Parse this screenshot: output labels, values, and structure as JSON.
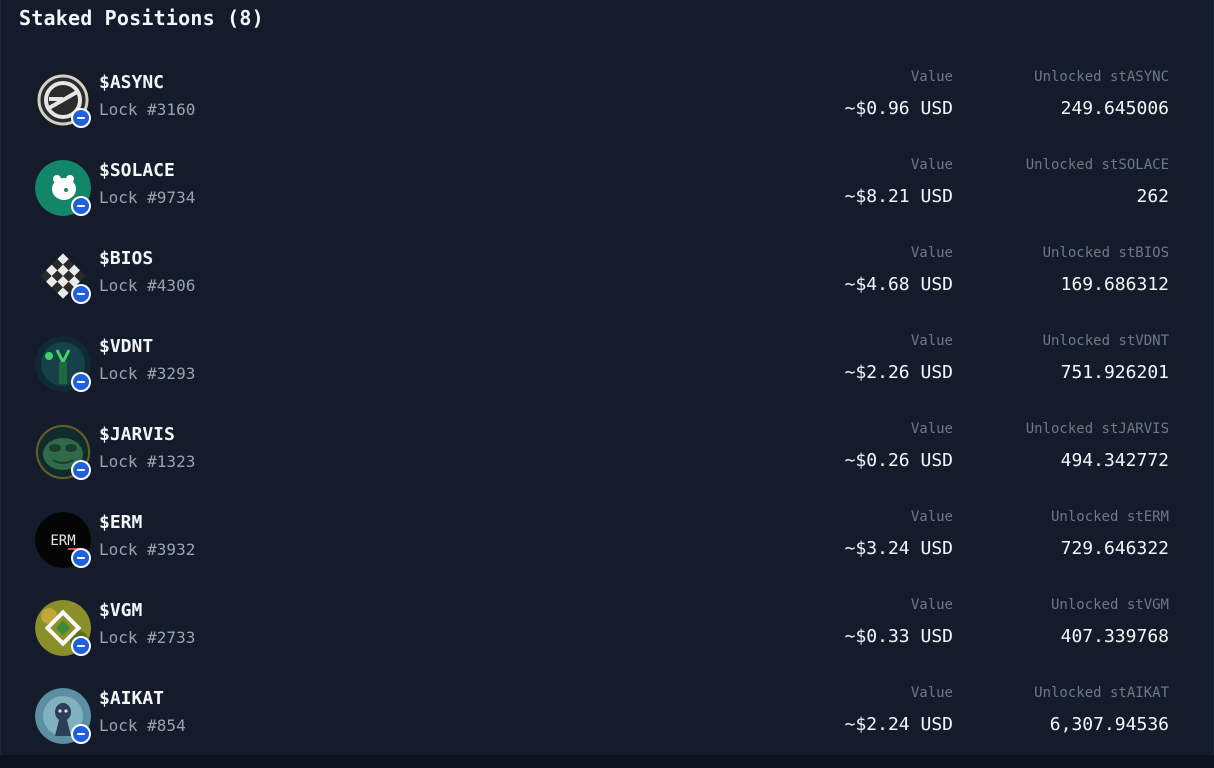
{
  "header": {
    "title": "Staked Positions (8)"
  },
  "labels": {
    "value": "Value"
  },
  "positions": [
    {
      "ticker": "$ASYNC",
      "lock": "Lock #3160",
      "value": "~$0.96 USD",
      "unlocked_label": "Unlocked stASYNC",
      "unlocked": "249.645006",
      "icon": "async-logo-icon"
    },
    {
      "ticker": "$SOLACE",
      "lock": "Lock #9734",
      "value": "~$8.21 USD",
      "unlocked_label": "Unlocked stSOLACE",
      "unlocked": "262",
      "icon": "solace-logo-icon"
    },
    {
      "ticker": "$BIOS",
      "lock": "Lock #4306",
      "value": "~$4.68 USD",
      "unlocked_label": "Unlocked stBIOS",
      "unlocked": "169.686312",
      "icon": "bios-logo-icon"
    },
    {
      "ticker": "$VDNT",
      "lock": "Lock #3293",
      "value": "~$2.26 USD",
      "unlocked_label": "Unlocked stVDNT",
      "unlocked": "751.926201",
      "icon": "vdnt-logo-icon"
    },
    {
      "ticker": "$JARVIS",
      "lock": "Lock #1323",
      "value": "~$0.26 USD",
      "unlocked_label": "Unlocked stJARVIS",
      "unlocked": "494.342772",
      "icon": "jarvis-logo-icon"
    },
    {
      "ticker": "$ERM",
      "lock": "Lock #3932",
      "value": "~$3.24 USD",
      "unlocked_label": "Unlocked stERM",
      "unlocked": "729.646322",
      "icon": "erm-logo-icon",
      "icon_text": "ERM"
    },
    {
      "ticker": "$VGM",
      "lock": "Lock #2733",
      "value": "~$0.33 USD",
      "unlocked_label": "Unlocked stVGM",
      "unlocked": "407.339768",
      "icon": "vgm-logo-icon"
    },
    {
      "ticker": "$AIKAT",
      "lock": "Lock #854",
      "value": "~$2.24 USD",
      "unlocked_label": "Unlocked stAIKAT",
      "unlocked": "6,307.94536",
      "icon": "aikat-logo-icon"
    }
  ],
  "badge": {
    "icon": "base-chain-badge-icon",
    "color": "#1f5fe0"
  },
  "colors": {
    "background": "#141c2b",
    "text": "#f4f6fa",
    "muted": "#6f7889",
    "lock": "#9aa3b2"
  }
}
